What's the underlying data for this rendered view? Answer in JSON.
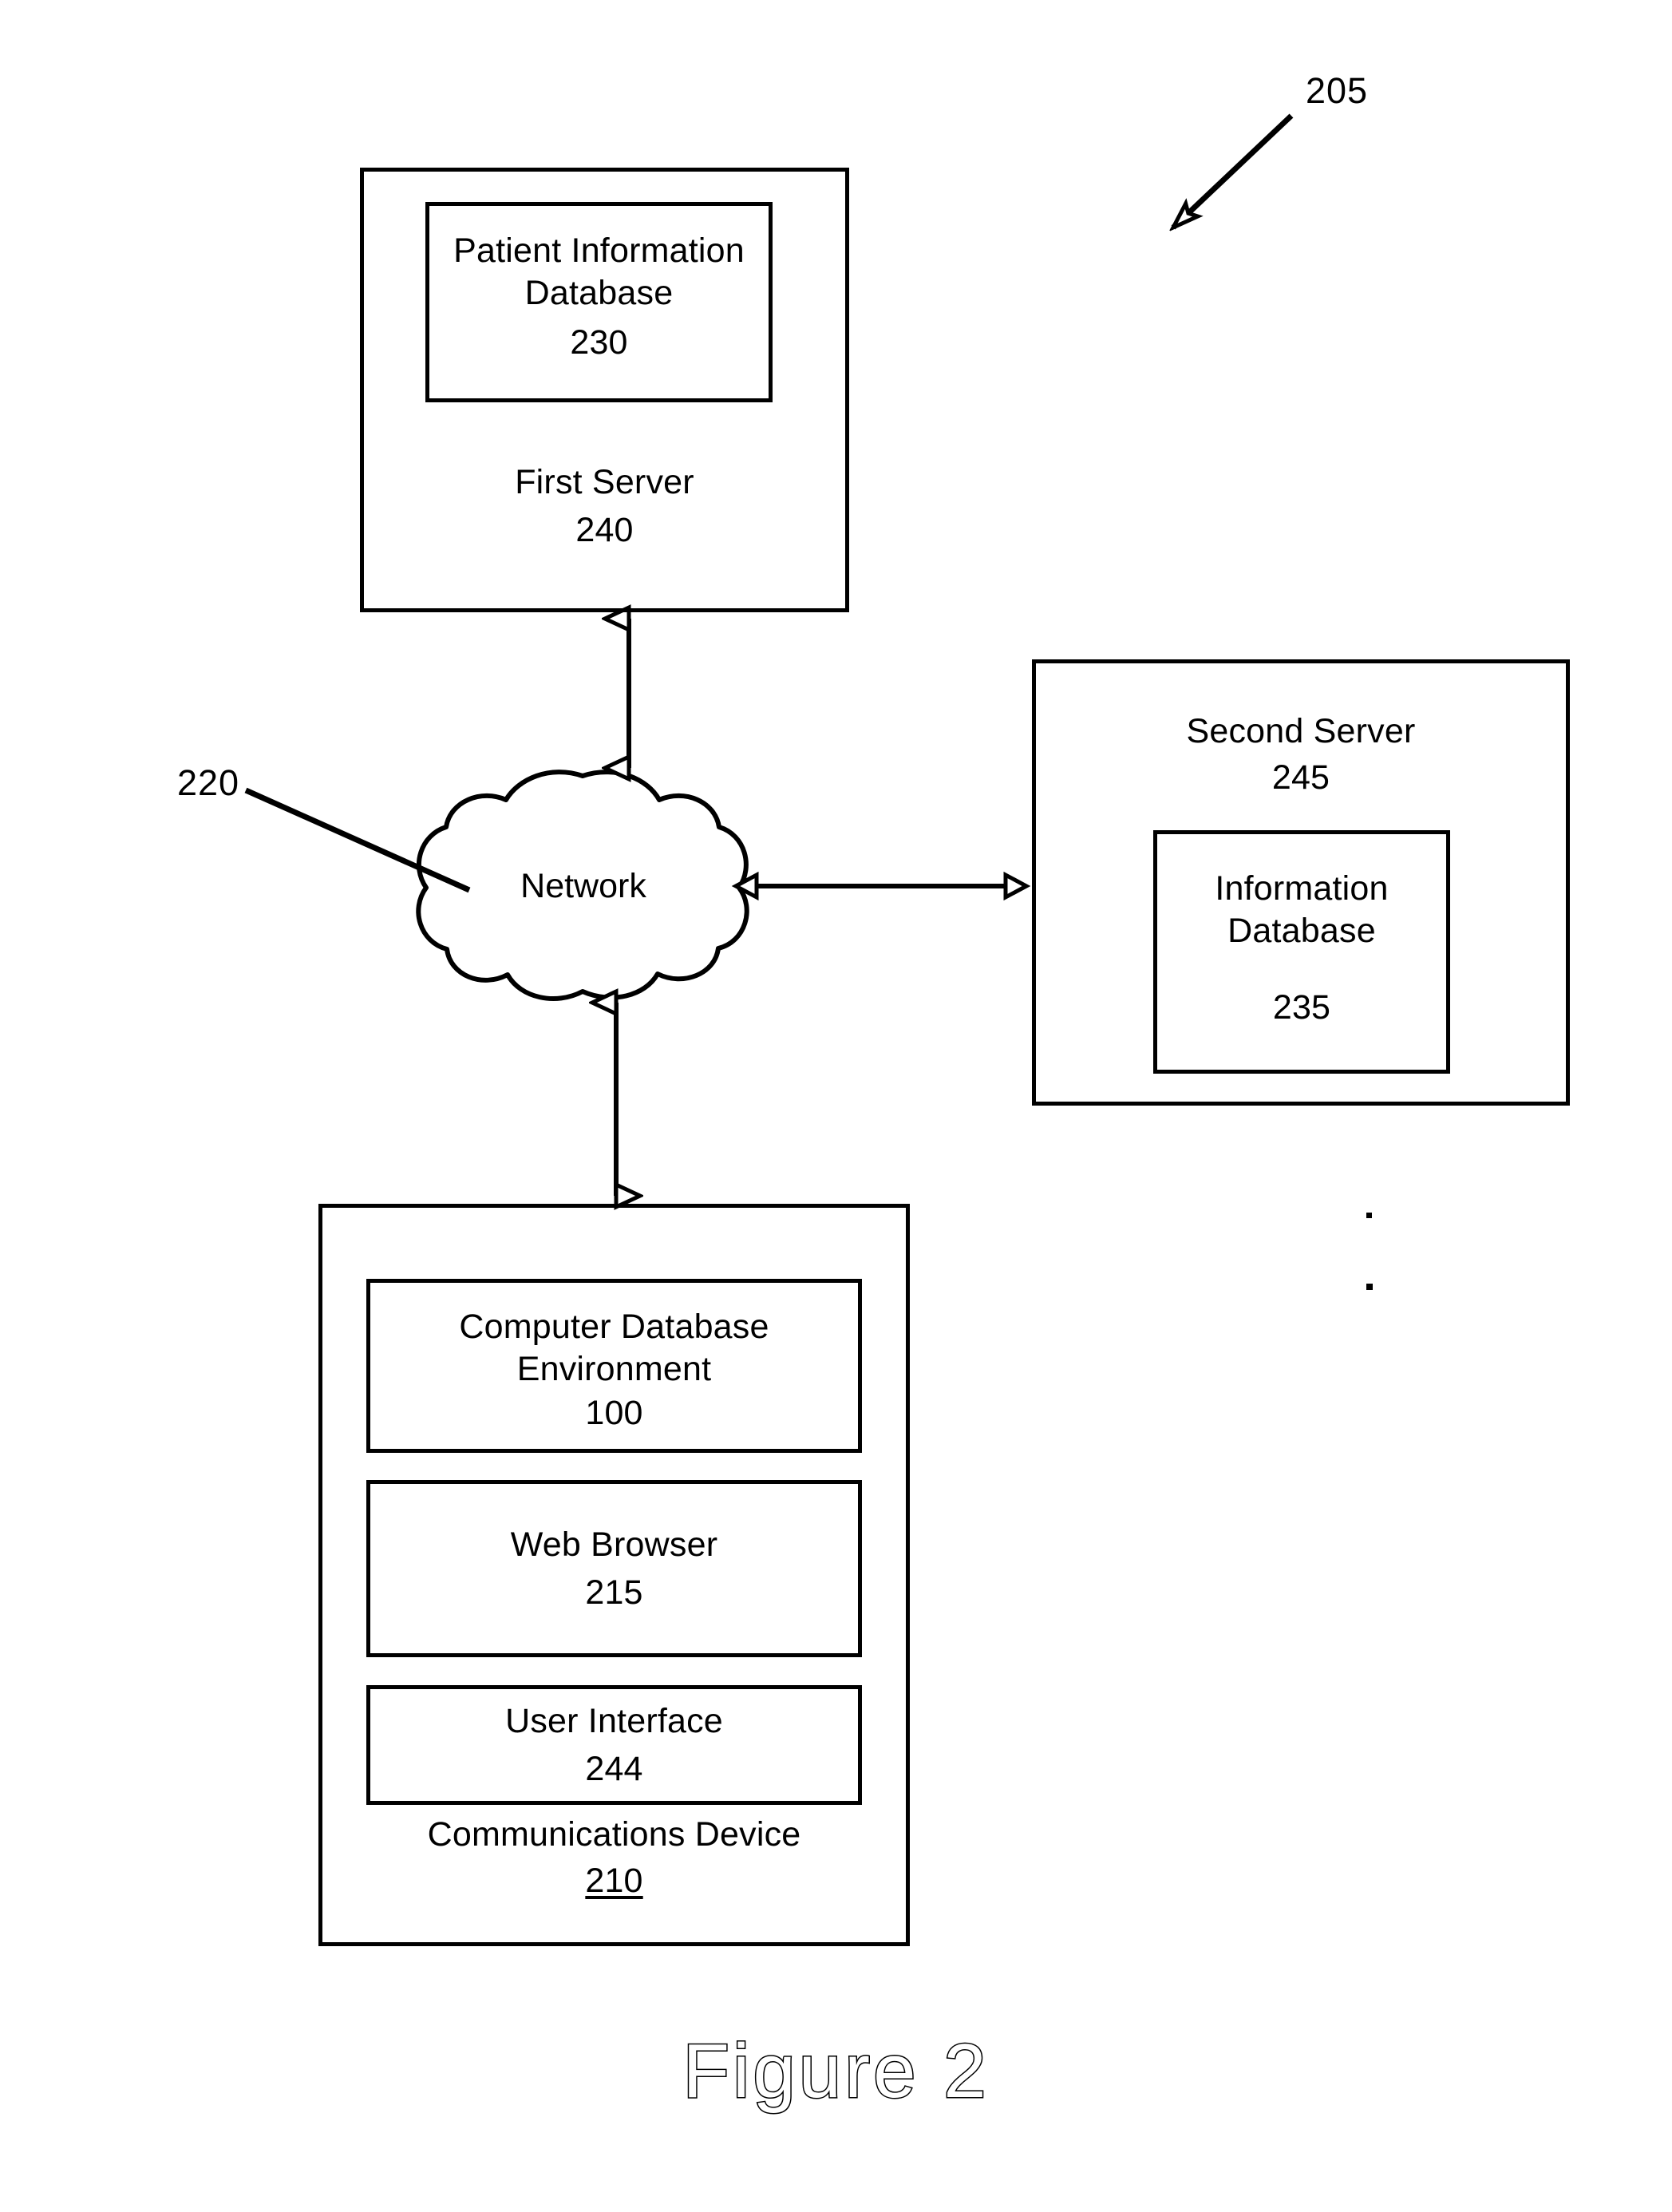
{
  "figure": {
    "caption": "Figure 2",
    "system_ref": "205",
    "network_ref": "220"
  },
  "nodes": {
    "first_server": {
      "label": "First Server",
      "ref": "240",
      "inner": {
        "label": "Patient Information\nDatabase",
        "ref": "230"
      }
    },
    "second_server": {
      "label": "Second Server",
      "ref": "245",
      "inner": {
        "label": "Information\nDatabase",
        "ref": "235"
      }
    },
    "network": {
      "label": "Network"
    },
    "communications_device": {
      "label": "Communications Device",
      "ref": "210",
      "modules": [
        {
          "label": "Computer Database\nEnvironment",
          "ref": "100"
        },
        {
          "label": "Web Browser",
          "ref": "215"
        },
        {
          "label": "User Interface",
          "ref": "244"
        }
      ]
    }
  },
  "connections": [
    {
      "from": "network",
      "to": "first_server",
      "style": "double-arrow-vertical"
    },
    {
      "from": "network",
      "to": "second_server",
      "style": "double-arrow-horizontal"
    },
    {
      "from": "network",
      "to": "communications_device",
      "style": "double-arrow-vertical"
    }
  ],
  "colors": {
    "ink": "#000000",
    "paper": "#ffffff"
  }
}
